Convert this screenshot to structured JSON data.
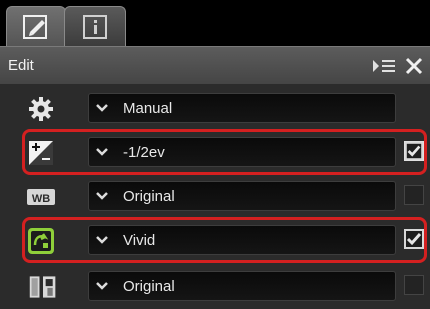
{
  "tabs": [
    {
      "icon": "edit-pencil-icon"
    },
    {
      "icon": "info-icon"
    }
  ],
  "header": {
    "title": "Edit",
    "menu_icon": "list-menu-icon",
    "close_icon": "close-icon"
  },
  "rows": [
    {
      "icon": "gear-icon",
      "value": "Manual",
      "checked": null
    },
    {
      "icon": "exposure-compensation-icon",
      "value": "-1/2ev",
      "checked": true,
      "highlighted": true
    },
    {
      "icon": "white-balance-icon",
      "value": "Original",
      "checked": false
    },
    {
      "icon": "picture-control-icon",
      "value": "Vivid",
      "checked": true,
      "highlighted": true
    },
    {
      "icon": "active-d-lighting-icon",
      "value": "Original",
      "checked": false
    }
  ],
  "wb_label": "WB",
  "colors": {
    "highlight": "#d42020",
    "background": "#2b2b2b",
    "accent_green": "#8fcf3a"
  }
}
